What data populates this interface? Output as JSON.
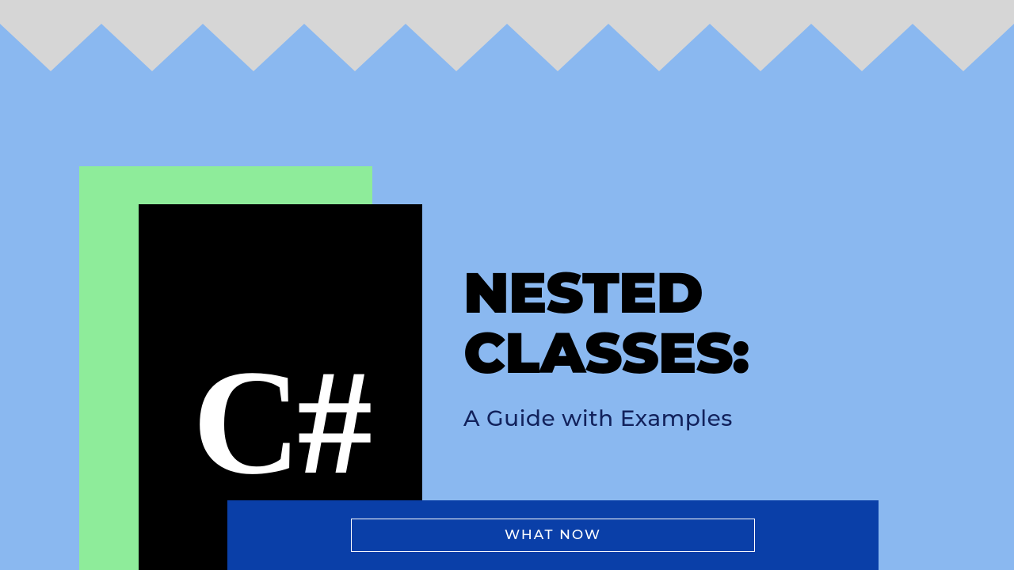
{
  "logo": "C#",
  "title_line1": "NESTED",
  "title_line2": "CLASSES:",
  "subtitle": "A Guide with Examples",
  "cta_label": "WHAT NOW",
  "colors": {
    "background": "#8ab8f0",
    "zigzag": "#d6d6d6",
    "green": "#8eec9a",
    "black": "#000000",
    "blue": "#0a3fa8"
  }
}
